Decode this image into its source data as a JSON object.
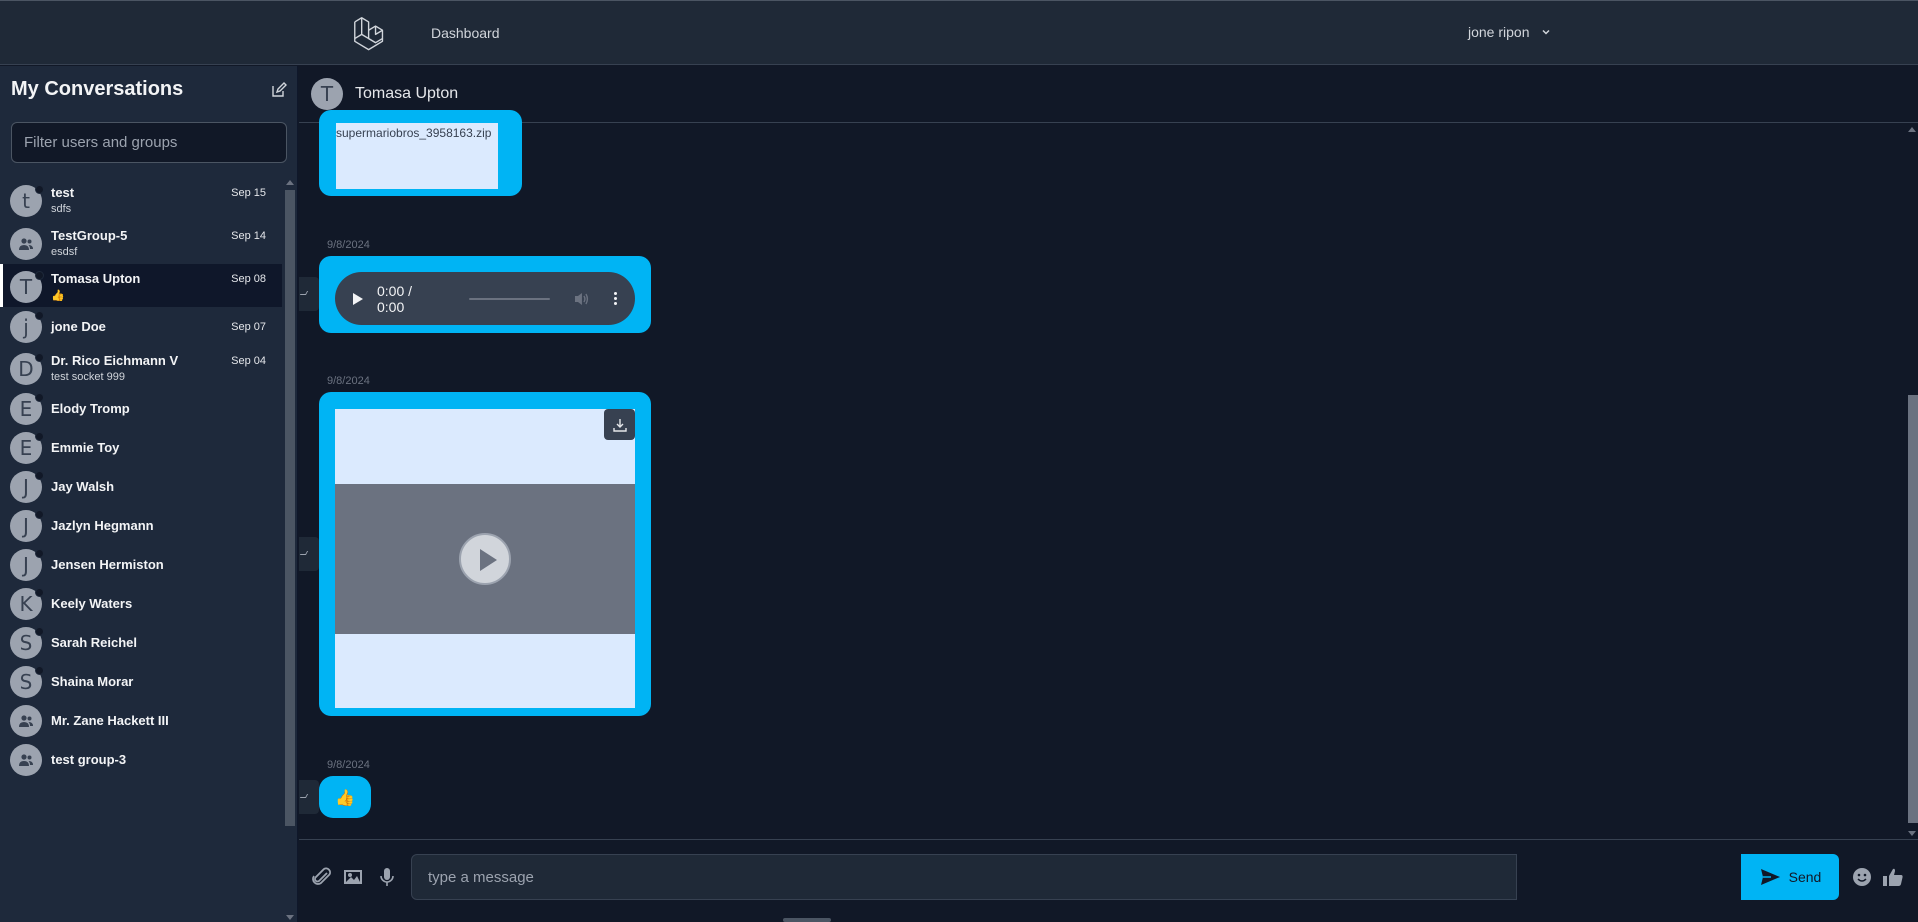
{
  "nav": {
    "logo": "laravel-logo",
    "links": [
      "Dashboard"
    ],
    "user": "jone ripon"
  },
  "sidebar": {
    "title": "My Conversations",
    "filter_placeholder": "Filter users and groups",
    "conversations": [
      {
        "name": "test",
        "avatar": "t",
        "message": "sdfs",
        "date": "Sep 15",
        "type": "user"
      },
      {
        "name": "TestGroup-5",
        "avatar": "group-icon",
        "message": "esdsf",
        "date": "Sep 14",
        "type": "group"
      },
      {
        "name": "Tomasa Upton",
        "avatar": "T",
        "message": "👍",
        "date": "Sep 08",
        "type": "user",
        "active": true
      },
      {
        "name": "jone Doe",
        "avatar": "j",
        "message": "",
        "date": "Sep 07",
        "type": "user"
      },
      {
        "name": "Dr. Rico Eichmann V",
        "avatar": "D",
        "message": "test socket 999",
        "date": "Sep 04",
        "type": "user"
      },
      {
        "name": "Elody Tromp",
        "avatar": "E",
        "message": "",
        "date": "",
        "type": "user"
      },
      {
        "name": "Emmie Toy",
        "avatar": "E",
        "message": "",
        "date": "",
        "type": "user"
      },
      {
        "name": "Jay Walsh",
        "avatar": "J",
        "message": "",
        "date": "",
        "type": "user"
      },
      {
        "name": "Jazlyn Hegmann",
        "avatar": "J",
        "message": "",
        "date": "",
        "type": "user"
      },
      {
        "name": "Jensen Hermiston",
        "avatar": "J",
        "message": "",
        "date": "",
        "type": "user"
      },
      {
        "name": "Keely Waters",
        "avatar": "K",
        "message": "",
        "date": "",
        "type": "user"
      },
      {
        "name": "Sarah Reichel",
        "avatar": "S",
        "message": "",
        "date": "",
        "type": "user"
      },
      {
        "name": "Shaina Morar",
        "avatar": "S",
        "message": "",
        "date": "",
        "type": "user"
      },
      {
        "name": "Mr. Zane Hackett III",
        "avatar": "group-icon",
        "message": "",
        "date": "",
        "type": "group"
      },
      {
        "name": "test group-3",
        "avatar": "group-icon",
        "message": "",
        "date": "",
        "type": "group"
      }
    ]
  },
  "chat": {
    "name": "Tomasa Upton",
    "avatar": "T",
    "messages": [
      {
        "kind": "file",
        "file_name": "supermariobros_3958163.zip"
      },
      {
        "kind": "audio",
        "date": "9/8/2024",
        "time": "0:00 / 0:00"
      },
      {
        "kind": "video",
        "date": "9/8/2024"
      },
      {
        "kind": "emoji",
        "date": "9/8/2024",
        "content": "👍"
      }
    ]
  },
  "composer": {
    "placeholder": "type a message",
    "send_label": "Send"
  },
  "colors": {
    "accent": "#00b4f4",
    "background": "#111827",
    "sidebar": "#1e293b"
  }
}
